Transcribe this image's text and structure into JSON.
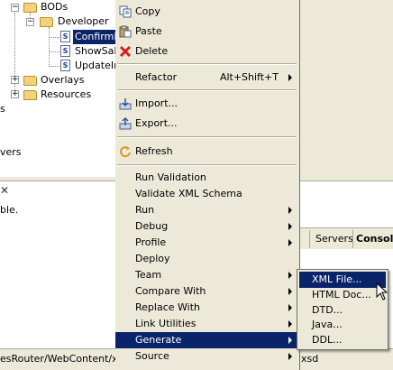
{
  "tree": {
    "items": [
      {
        "label": "BODs",
        "kind": "folder",
        "icon": "folder-icon"
      },
      {
        "label": "Developer",
        "kind": "folder",
        "icon": "folder-icon"
      },
      {
        "label": "ConfirmB",
        "kind": "file",
        "icon": "schema-file-icon",
        "selected": true
      },
      {
        "label": "ShowSale",
        "kind": "file",
        "icon": "schema-file-icon"
      },
      {
        "label": "UpdateIn",
        "kind": "file",
        "icon": "schema-file-icon"
      },
      {
        "label": "Overlays",
        "kind": "folder",
        "icon": "folder-icon"
      },
      {
        "label": "Resources",
        "kind": "folder",
        "icon": "folder-icon"
      }
    ],
    "file_icon_letter": "S",
    "expand_glyph": "+",
    "collapse_glyph": "−",
    "fragment_s": "s",
    "fragment_vers": "vers"
  },
  "bottom_panel": {
    "close_glyph": "✕",
    "text": "ble.",
    "tabs": [
      {
        "label": "Servers"
      },
      {
        "label": "Console",
        "active": true
      }
    ]
  },
  "status": {
    "left_text": "esRouter/WebContent/xsd",
    "right_text": "xsd"
  },
  "context_menu": {
    "items": [
      {
        "label": "Copy",
        "icon": "copy-icon"
      },
      {
        "label": "Paste",
        "icon": "paste-icon"
      },
      {
        "label": "Delete",
        "icon": "delete-icon"
      },
      {
        "separator": true
      },
      {
        "label": "Refactor",
        "shortcut": "Alt+Shift+T",
        "submenu": true
      },
      {
        "separator": true
      },
      {
        "label": "Import...",
        "icon": "import-icon"
      },
      {
        "label": "Export...",
        "icon": "export-icon"
      },
      {
        "separator": true
      },
      {
        "label": "Refresh",
        "icon": "refresh-icon"
      },
      {
        "separator": true
      },
      {
        "label": "Run Validation"
      },
      {
        "label": "Validate XML Schema"
      },
      {
        "label": "Run",
        "submenu": true
      },
      {
        "label": "Debug",
        "submenu": true
      },
      {
        "label": "Profile",
        "submenu": true
      },
      {
        "label": "Deploy"
      },
      {
        "label": "Team",
        "submenu": true
      },
      {
        "label": "Compare With",
        "submenu": true
      },
      {
        "label": "Replace With",
        "submenu": true
      },
      {
        "label": "Link Utilities",
        "submenu": true
      },
      {
        "label": "Generate",
        "submenu": true,
        "highlighted": true
      },
      {
        "label": "Source",
        "submenu": true
      }
    ]
  },
  "generate_submenu": {
    "items": [
      {
        "label": "XML File...",
        "highlighted": true
      },
      {
        "label": "HTML Doc..."
      },
      {
        "label": "DTD..."
      },
      {
        "label": "Java..."
      },
      {
        "label": "DDL..."
      }
    ]
  },
  "colors": {
    "menu_bg": "#ece9d8",
    "highlight": "#0a246a",
    "highlight_text": "#ffffff"
  }
}
